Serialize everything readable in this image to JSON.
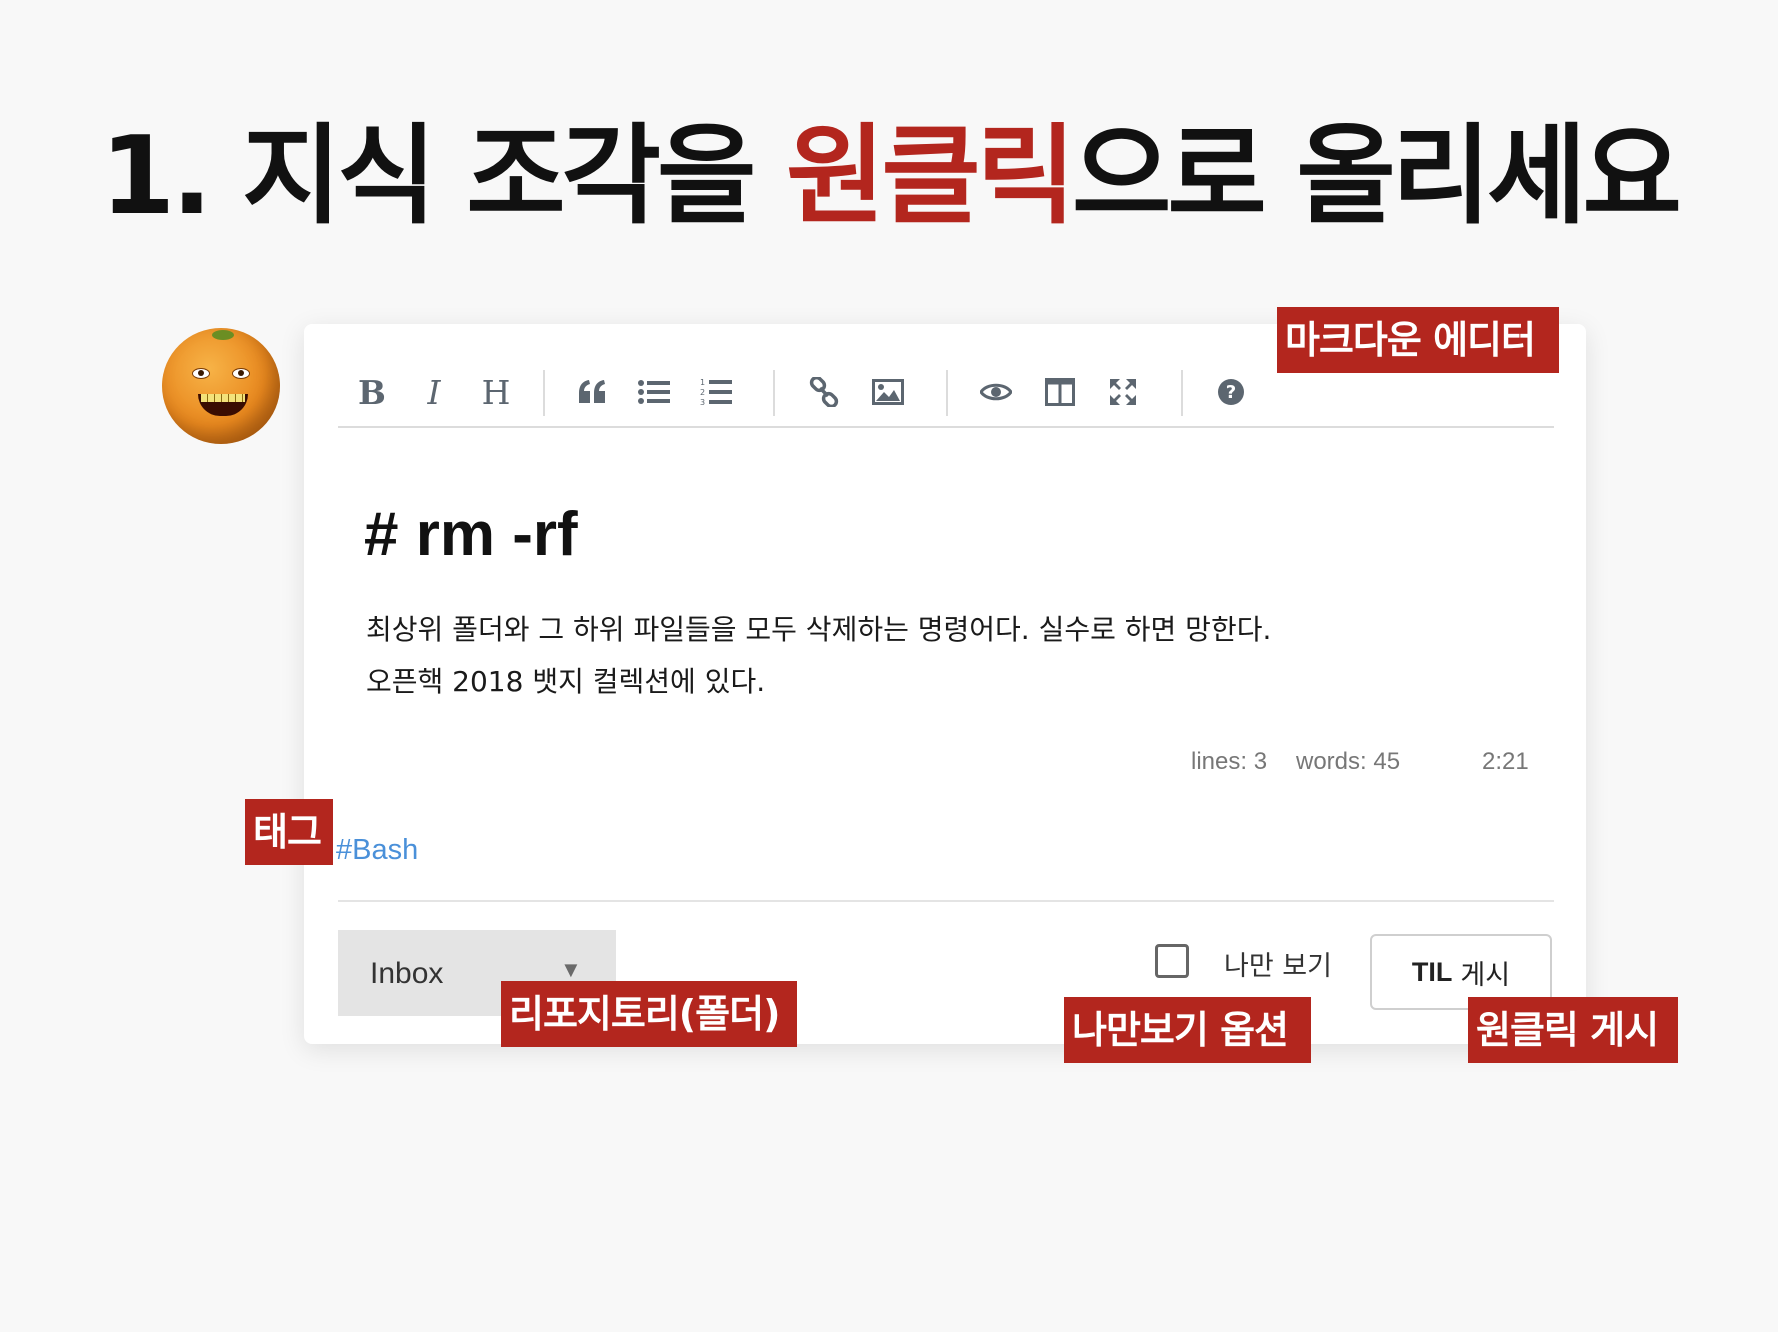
{
  "headline": {
    "prefix": "1. 지식 조각을 ",
    "accent": "원클릭",
    "suffix": "으로 올리세요"
  },
  "colors": {
    "accent": "#b3261e",
    "tag": "#4a90d9"
  },
  "toolbar": {
    "buttons": [
      {
        "name": "bold-icon",
        "glyph": "B"
      },
      {
        "name": "italic-icon",
        "glyph": "I"
      },
      {
        "name": "heading-icon",
        "glyph": "H"
      },
      {
        "name": "quote-icon",
        "glyph": "❝"
      },
      {
        "name": "unordered-list-icon",
        "glyph": "list"
      },
      {
        "name": "ordered-list-icon",
        "glyph": "list-ol"
      },
      {
        "name": "link-icon",
        "glyph": "link"
      },
      {
        "name": "image-icon",
        "glyph": "image"
      },
      {
        "name": "preview-icon",
        "glyph": "eye"
      },
      {
        "name": "side-by-side-icon",
        "glyph": "columns"
      },
      {
        "name": "fullscreen-icon",
        "glyph": "expand"
      },
      {
        "name": "help-icon",
        "glyph": "question"
      }
    ]
  },
  "editor": {
    "heading": "# rm -rf",
    "lines": [
      "최상위 폴더와 그 하위 파일들을 모두 삭제하는 명령어다. 실수로 하면 망한다.",
      "오픈핵 2018 뱃지 컬렉션에 있다."
    ],
    "status": {
      "lines": "lines: 3",
      "words": "words: 45",
      "cursor": "2:21"
    }
  },
  "tag": "#Bash",
  "footer": {
    "folder_value": "Inbox",
    "private_label": "나만 보기",
    "private_checked": false,
    "post_button_bold": "TIL",
    "post_button_rest": "게시"
  },
  "callouts": {
    "editor": "마크다운 에디터",
    "tag": "태그",
    "folder": "리포지토리(폴더)",
    "private": "나만보기 옵션",
    "post": "원클릭 게시"
  }
}
